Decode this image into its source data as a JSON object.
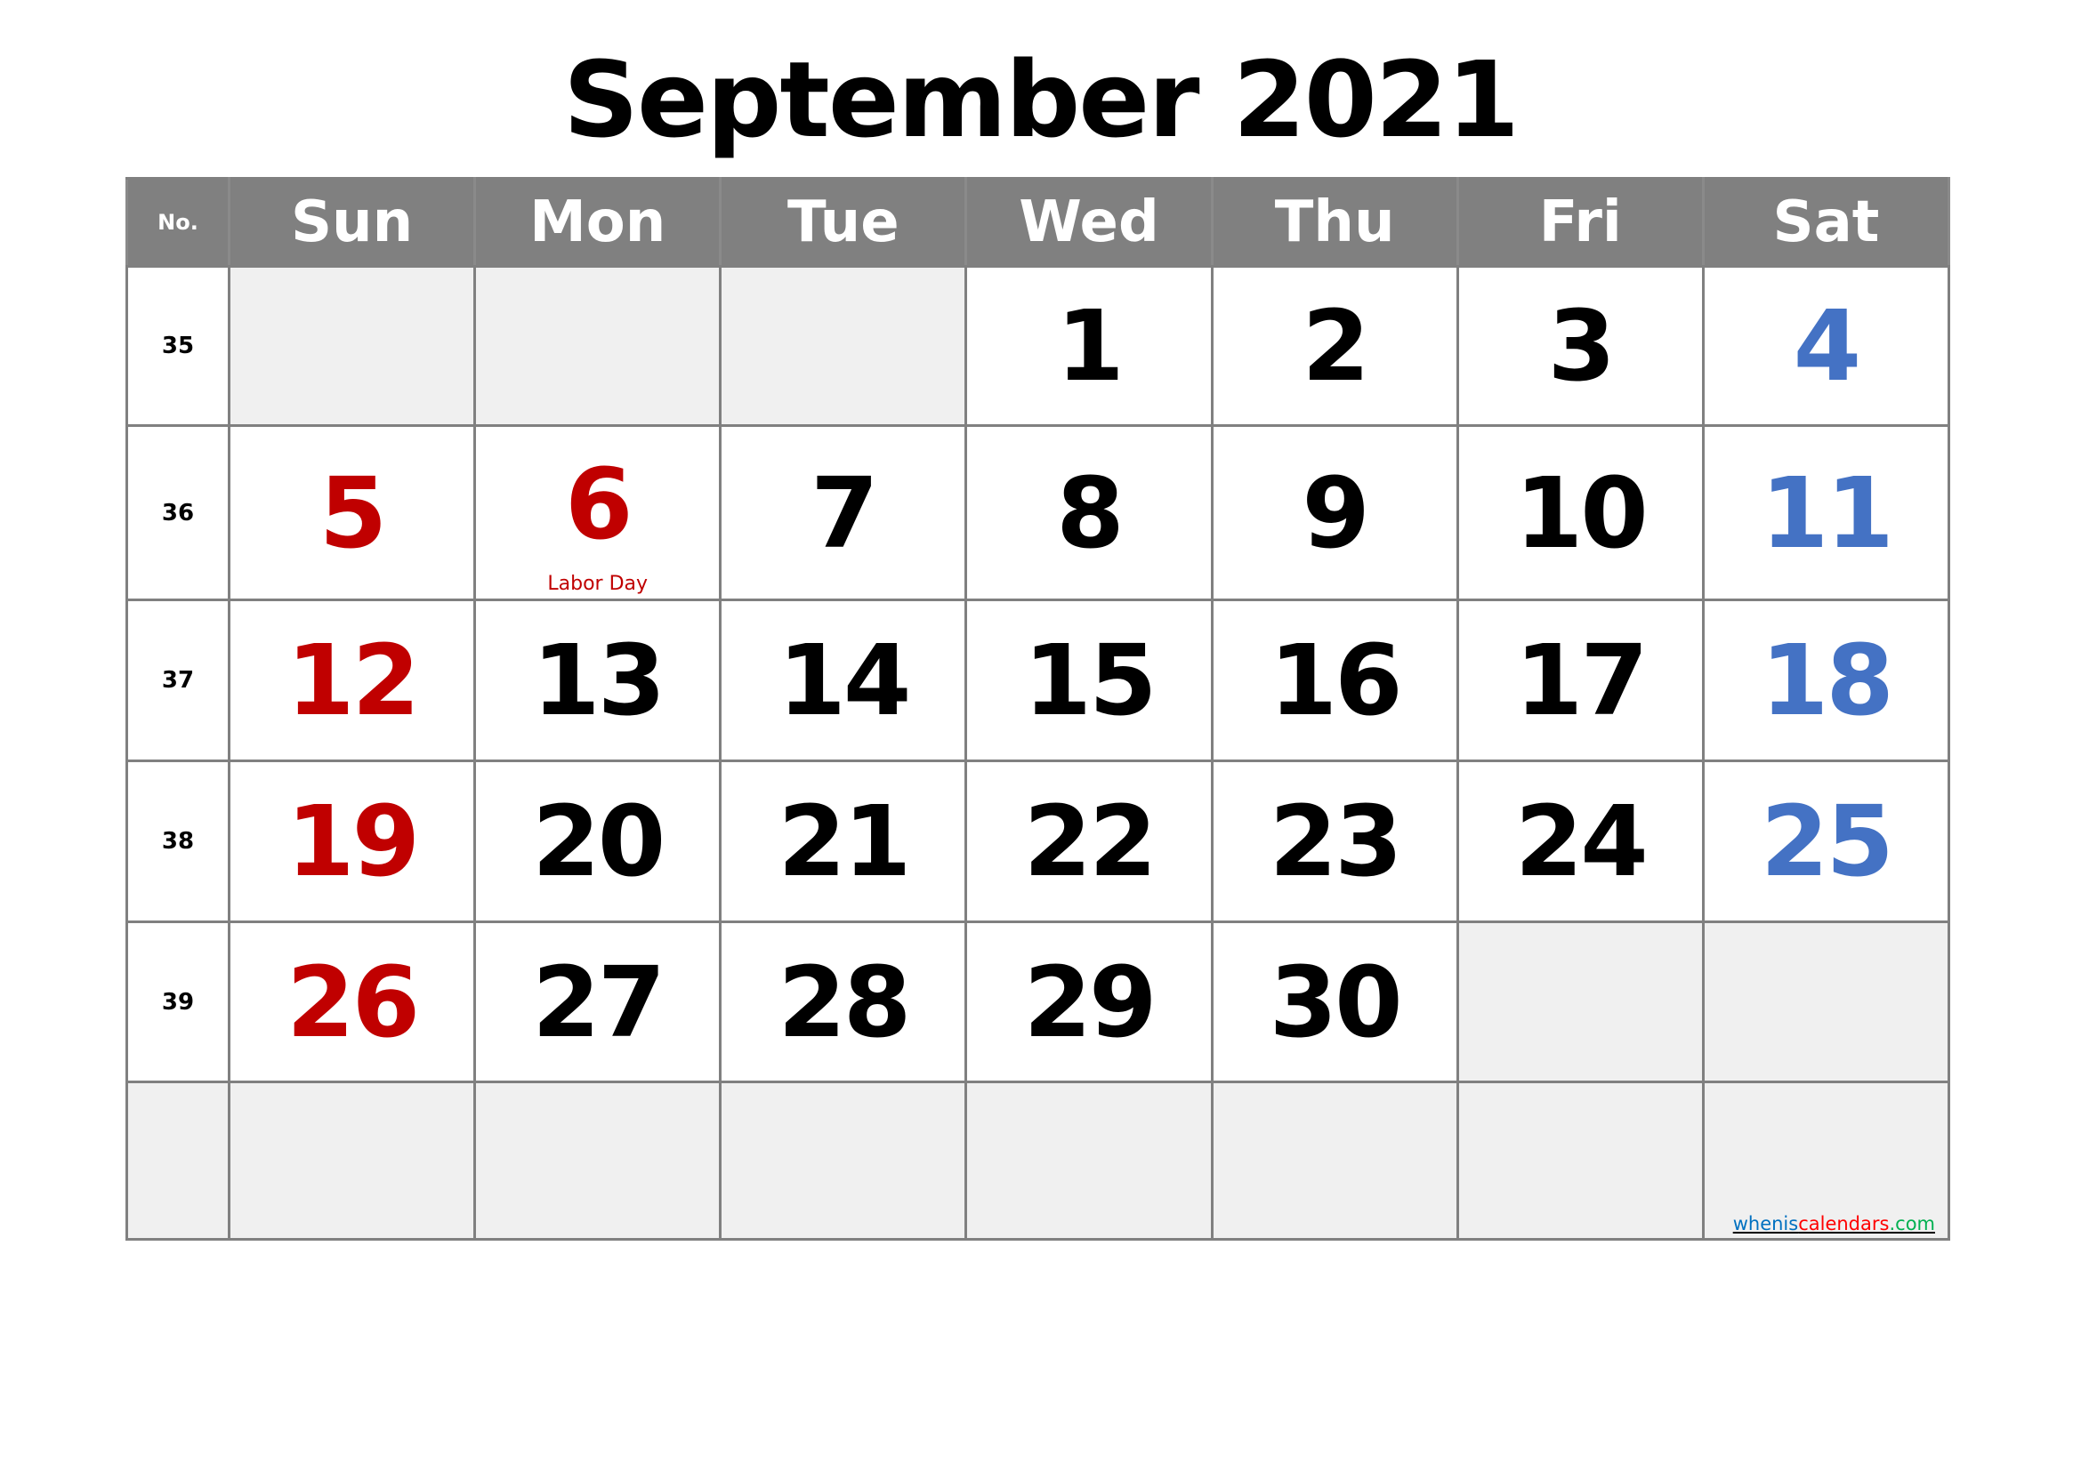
{
  "title": "September 2021",
  "header": {
    "no_label": "No.",
    "days": [
      "Sun",
      "Mon",
      "Tue",
      "Wed",
      "Thu",
      "Fri",
      "Sat"
    ]
  },
  "colors": {
    "header_bg": "#808080",
    "sunday_holiday": "#C00000",
    "saturday": "#4472C4",
    "blank_cell": "#F0F0F0"
  },
  "weeks": [
    {
      "no": "35",
      "days": [
        "",
        "",
        "",
        "1",
        "2",
        "3",
        "4"
      ]
    },
    {
      "no": "36",
      "days": [
        "5",
        "6",
        "7",
        "8",
        "9",
        "10",
        "11"
      ]
    },
    {
      "no": "37",
      "days": [
        "12",
        "13",
        "14",
        "15",
        "16",
        "17",
        "18"
      ]
    },
    {
      "no": "38",
      "days": [
        "19",
        "20",
        "21",
        "22",
        "23",
        "24",
        "25"
      ]
    },
    {
      "no": "39",
      "days": [
        "26",
        "27",
        "28",
        "29",
        "30",
        "",
        ""
      ]
    },
    {
      "no": "",
      "days": [
        "",
        "",
        "",
        "",
        "",
        "",
        ""
      ]
    }
  ],
  "holidays": [
    {
      "day": "6",
      "label": "Labor Day"
    }
  ],
  "footer": {
    "part1": "whenis",
    "part2": "calendars",
    "part3": ".com"
  }
}
